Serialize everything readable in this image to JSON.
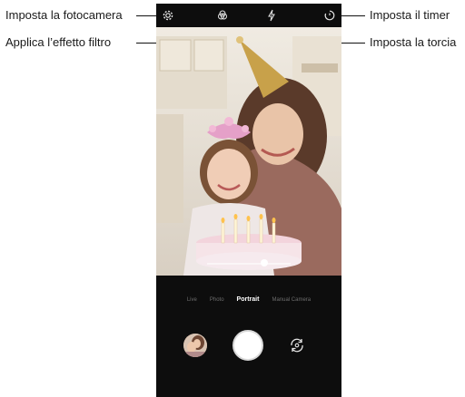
{
  "callouts": {
    "camera_settings": "Imposta la fotocamera",
    "filter_effect": "Applica l’effetto filtro",
    "timer": "Imposta il timer",
    "torch": "Imposta la torcia"
  },
  "camera": {
    "modes": [
      "Live",
      "Photo",
      "Portrait",
      "Manual Camera"
    ],
    "active_mode": "Portrait",
    "zoom_level": 0.65
  },
  "icons": {
    "settings": "gear-icon",
    "filter": "filter-icon",
    "flash": "flash-icon",
    "timer": "timer-icon",
    "gallery": "gallery-thumbnail",
    "shutter": "shutter-button",
    "switch": "camera-switch-icon"
  }
}
